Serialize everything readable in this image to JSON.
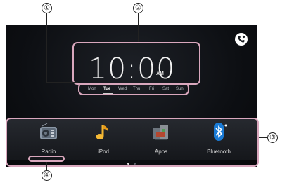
{
  "callouts": [
    "①",
    "②",
    "③",
    "④"
  ],
  "clock": {
    "time": "10:00",
    "ampm": "AM"
  },
  "days": [
    "Mon",
    "Tue",
    "Wed",
    "Thu",
    "Fri",
    "Sat",
    "Sun"
  ],
  "selected_day": "Tue",
  "apps": [
    {
      "label": "Radio",
      "icon": "radio-icon"
    },
    {
      "label": "iPod",
      "icon": "music-note-icon"
    },
    {
      "label": "Apps",
      "icon": "apps-icon"
    },
    {
      "label": "Bluetooth",
      "icon": "bluetooth-icon"
    }
  ],
  "page_indicator": {
    "pages": 2,
    "current": 1
  },
  "colors": {
    "highlight": "#d9a7bd",
    "screen_bg": "#0d0f13",
    "bluetooth_blue": "#1a7bd6"
  },
  "phone_button_icon": "phone-icon"
}
